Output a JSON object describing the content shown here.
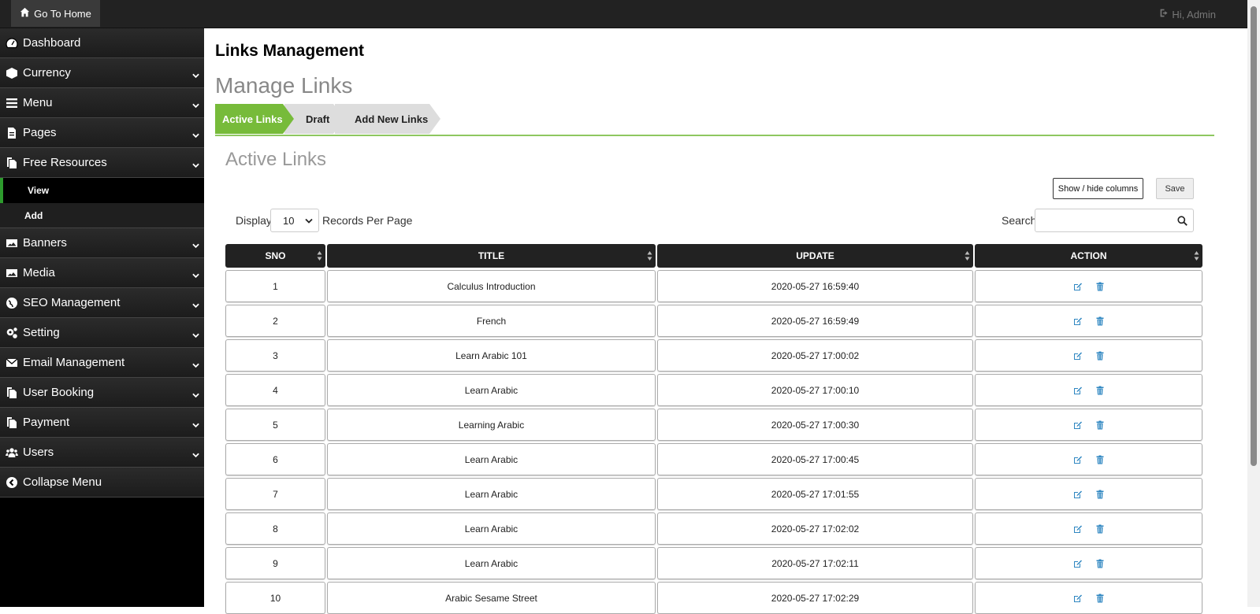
{
  "topbar": {
    "home_label": "Go To Home",
    "user_label": "Hi, Admin"
  },
  "sidebar": {
    "items_top": [
      {
        "label": "Dashboard",
        "icon": "dashboard-icon",
        "chevron": false
      },
      {
        "label": "Currency",
        "icon": "cube-icon",
        "chevron": true
      },
      {
        "label": "Menu",
        "icon": "bars-icon",
        "chevron": true
      },
      {
        "label": "Pages",
        "icon": "file-icon",
        "chevron": true
      },
      {
        "label": "Free Resources",
        "icon": "files-icon",
        "chevron": true
      }
    ],
    "sub_items": [
      {
        "label": "View",
        "active": true
      },
      {
        "label": "Add",
        "active": false
      }
    ],
    "items_bottom": [
      {
        "label": "Banners",
        "icon": "image-icon",
        "chevron": true
      },
      {
        "label": "Media",
        "icon": "image-icon",
        "chevron": true
      },
      {
        "label": "SEO Management",
        "icon": "globe-icon",
        "chevron": true
      },
      {
        "label": "Setting",
        "icon": "gears-icon",
        "chevron": true
      },
      {
        "label": "Email Management",
        "icon": "envelope-icon",
        "chevron": true
      },
      {
        "label": "User Booking",
        "icon": "files-icon",
        "chevron": true
      },
      {
        "label": "Payment",
        "icon": "files-icon",
        "chevron": true
      },
      {
        "label": "Users",
        "icon": "users-icon",
        "chevron": true
      },
      {
        "label": "Collapse Menu",
        "icon": "chevron-circle-left-icon",
        "chevron": false
      }
    ]
  },
  "main": {
    "page_title": "Links Management",
    "sub_title": "Manage Links",
    "tabs": [
      {
        "label": "Active Links"
      },
      {
        "label": "Draft"
      },
      {
        "label": "Add New Links"
      }
    ],
    "section_title": "Active Links",
    "show_hide_label": "Show / hide columns",
    "save_label": "Save",
    "display_label": "Display",
    "per_page_value": "10",
    "records_label": "Records Per Page",
    "search_label": "Search:"
  },
  "table": {
    "headers": [
      "SNO",
      "TITLE",
      "UPDATE",
      "ACTION"
    ],
    "rows": [
      {
        "sno": "1",
        "title": "Calculus Introduction",
        "update": "2020-05-27 16:59:40"
      },
      {
        "sno": "2",
        "title": "French",
        "update": "2020-05-27 16:59:49"
      },
      {
        "sno": "3",
        "title": "Learn Arabic 101",
        "update": "2020-05-27 17:00:02"
      },
      {
        "sno": "4",
        "title": "Learn Arabic",
        "update": "2020-05-27 17:00:10"
      },
      {
        "sno": "5",
        "title": "Learning Arabic",
        "update": "2020-05-27 17:00:30"
      },
      {
        "sno": "6",
        "title": "Learn Arabic",
        "update": "2020-05-27 17:00:45"
      },
      {
        "sno": "7",
        "title": "Learn Arabic",
        "update": "2020-05-27 17:01:55"
      },
      {
        "sno": "8",
        "title": "Learn Arabic",
        "update": "2020-05-27 17:02:02"
      },
      {
        "sno": "9",
        "title": "Learn Arabic",
        "update": "2020-05-27 17:02:11"
      },
      {
        "sno": "10",
        "title": "Arabic Sesame Street",
        "update": "2020-05-27 17:02:29"
      }
    ]
  },
  "colors": {
    "accent_green": "#77bb3a",
    "header_dark": "#222222",
    "action_blue": "#2e86c1"
  }
}
